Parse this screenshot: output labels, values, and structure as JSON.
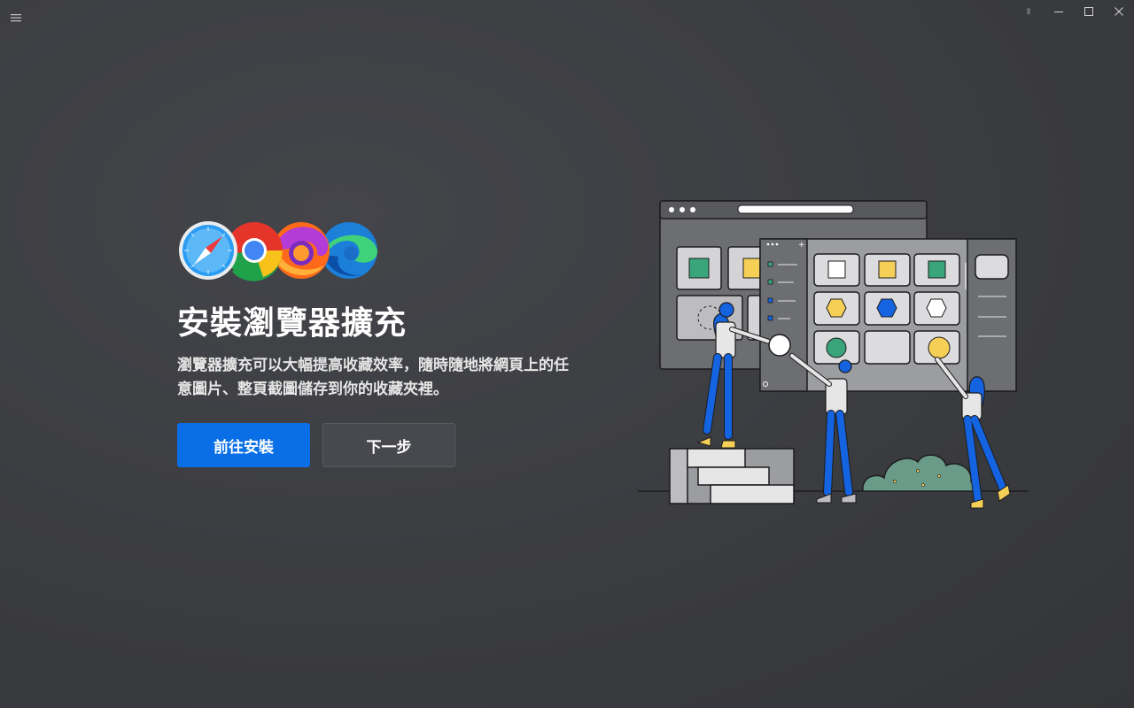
{
  "titlebar": {
    "menu_icon": "hamburger-icon",
    "controls": [
      "pin-icon",
      "minimize-icon",
      "maximize-icon",
      "close-icon"
    ]
  },
  "browsers": [
    "Safari",
    "Chrome",
    "Firefox",
    "Edge"
  ],
  "main": {
    "title": "安裝瀏覽器擴充",
    "description": "瀏覽器擴充可以大幅提高收藏效率，隨時隨地將網頁上的任意圖片、整頁截圖儲存到你的收藏夾裡。",
    "primary_button": "前往安裝",
    "secondary_button": "下一步"
  },
  "colors": {
    "background": "#3b3c40",
    "primary": "#0a6fe6",
    "secondary_button": "#48494e",
    "accent_green": "#3aa57a",
    "accent_yellow": "#f6cf57",
    "accent_blue": "#1463e0"
  }
}
